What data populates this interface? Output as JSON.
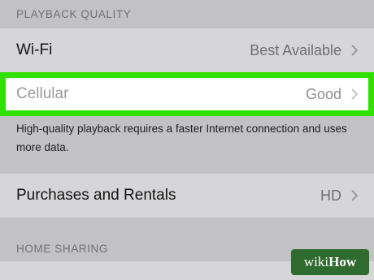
{
  "sections": {
    "playback_quality_header": "PLAYBACK QUALITY",
    "home_sharing_header": "HOME SHARING"
  },
  "rows": {
    "wifi": {
      "label": "Wi-Fi",
      "value": "Best Available"
    },
    "cellular": {
      "label": "Cellular",
      "value": "Good"
    },
    "purchases": {
      "label": "Purchases and Rentals",
      "value": "HD"
    }
  },
  "note": "High-quality playback requires a faster Internet connection and uses more data.",
  "watermark": {
    "wiki": "wiki",
    "how": "How"
  },
  "colors": {
    "highlight_border": "#2fe000",
    "background": "#c2c2c4",
    "row_background": "#d6d6d8",
    "watermark_bg": "#2f6b2e"
  }
}
